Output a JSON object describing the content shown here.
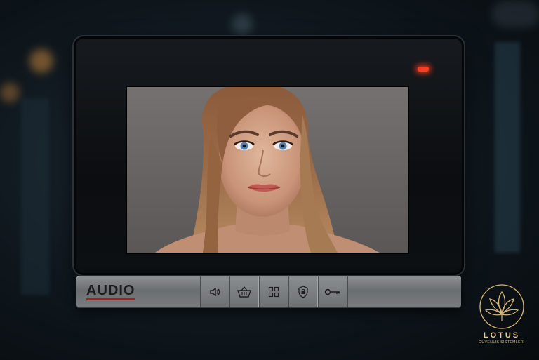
{
  "device": {
    "brand": "AUDIO",
    "status_led_color": "#ff3b22",
    "screen_content": "visitor-face",
    "buttons": [
      {
        "icon": "speaker-icon"
      },
      {
        "icon": "basket-icon"
      },
      {
        "icon": "grid-icon"
      },
      {
        "icon": "shield-lock-icon"
      },
      {
        "icon": "key-icon"
      }
    ]
  },
  "watermark": {
    "name": "LOTUS",
    "subtitle": "GÜVENLİK SİSTEMLERİ",
    "color": "#d7b877"
  }
}
